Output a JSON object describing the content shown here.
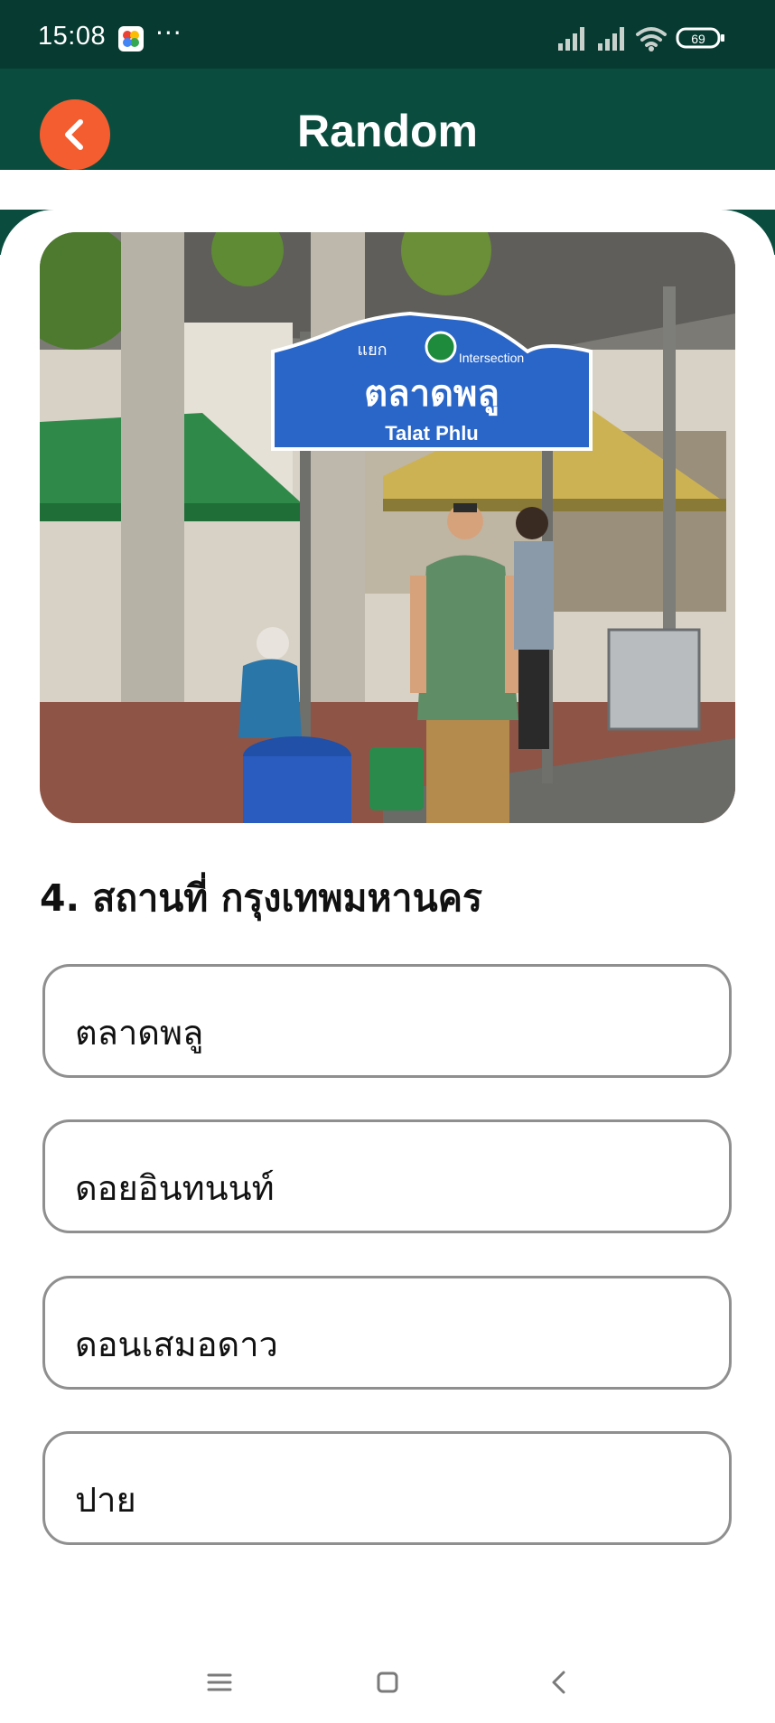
{
  "status_bar": {
    "time": "15:08",
    "more_indicator": "···",
    "battery": "69",
    "icons": [
      "google-photos-icon",
      "signal-icon",
      "signal-icon",
      "wifi-icon",
      "battery-icon"
    ]
  },
  "header": {
    "title": "Random",
    "back_icon": "chevron-left-icon",
    "back_color": "#f35d2f",
    "background": "#0a4d3f"
  },
  "photo": {
    "sign_top_left": "แยก",
    "sign_top_right": "Intersection",
    "sign_thai": "ตลาดพลู",
    "sign_english": "Talat Phlu"
  },
  "question": {
    "text": "4. สถานที่ กรุงเทพมหานคร"
  },
  "options": [
    {
      "label": "ตลาดพลู"
    },
    {
      "label": "ดอยอินทนนท์"
    },
    {
      "label": "ดอนเสมอดาว"
    },
    {
      "label": "ปาย"
    }
  ],
  "nav_bar": {
    "icons": [
      "menu-icon",
      "home-icon",
      "back-icon"
    ]
  }
}
